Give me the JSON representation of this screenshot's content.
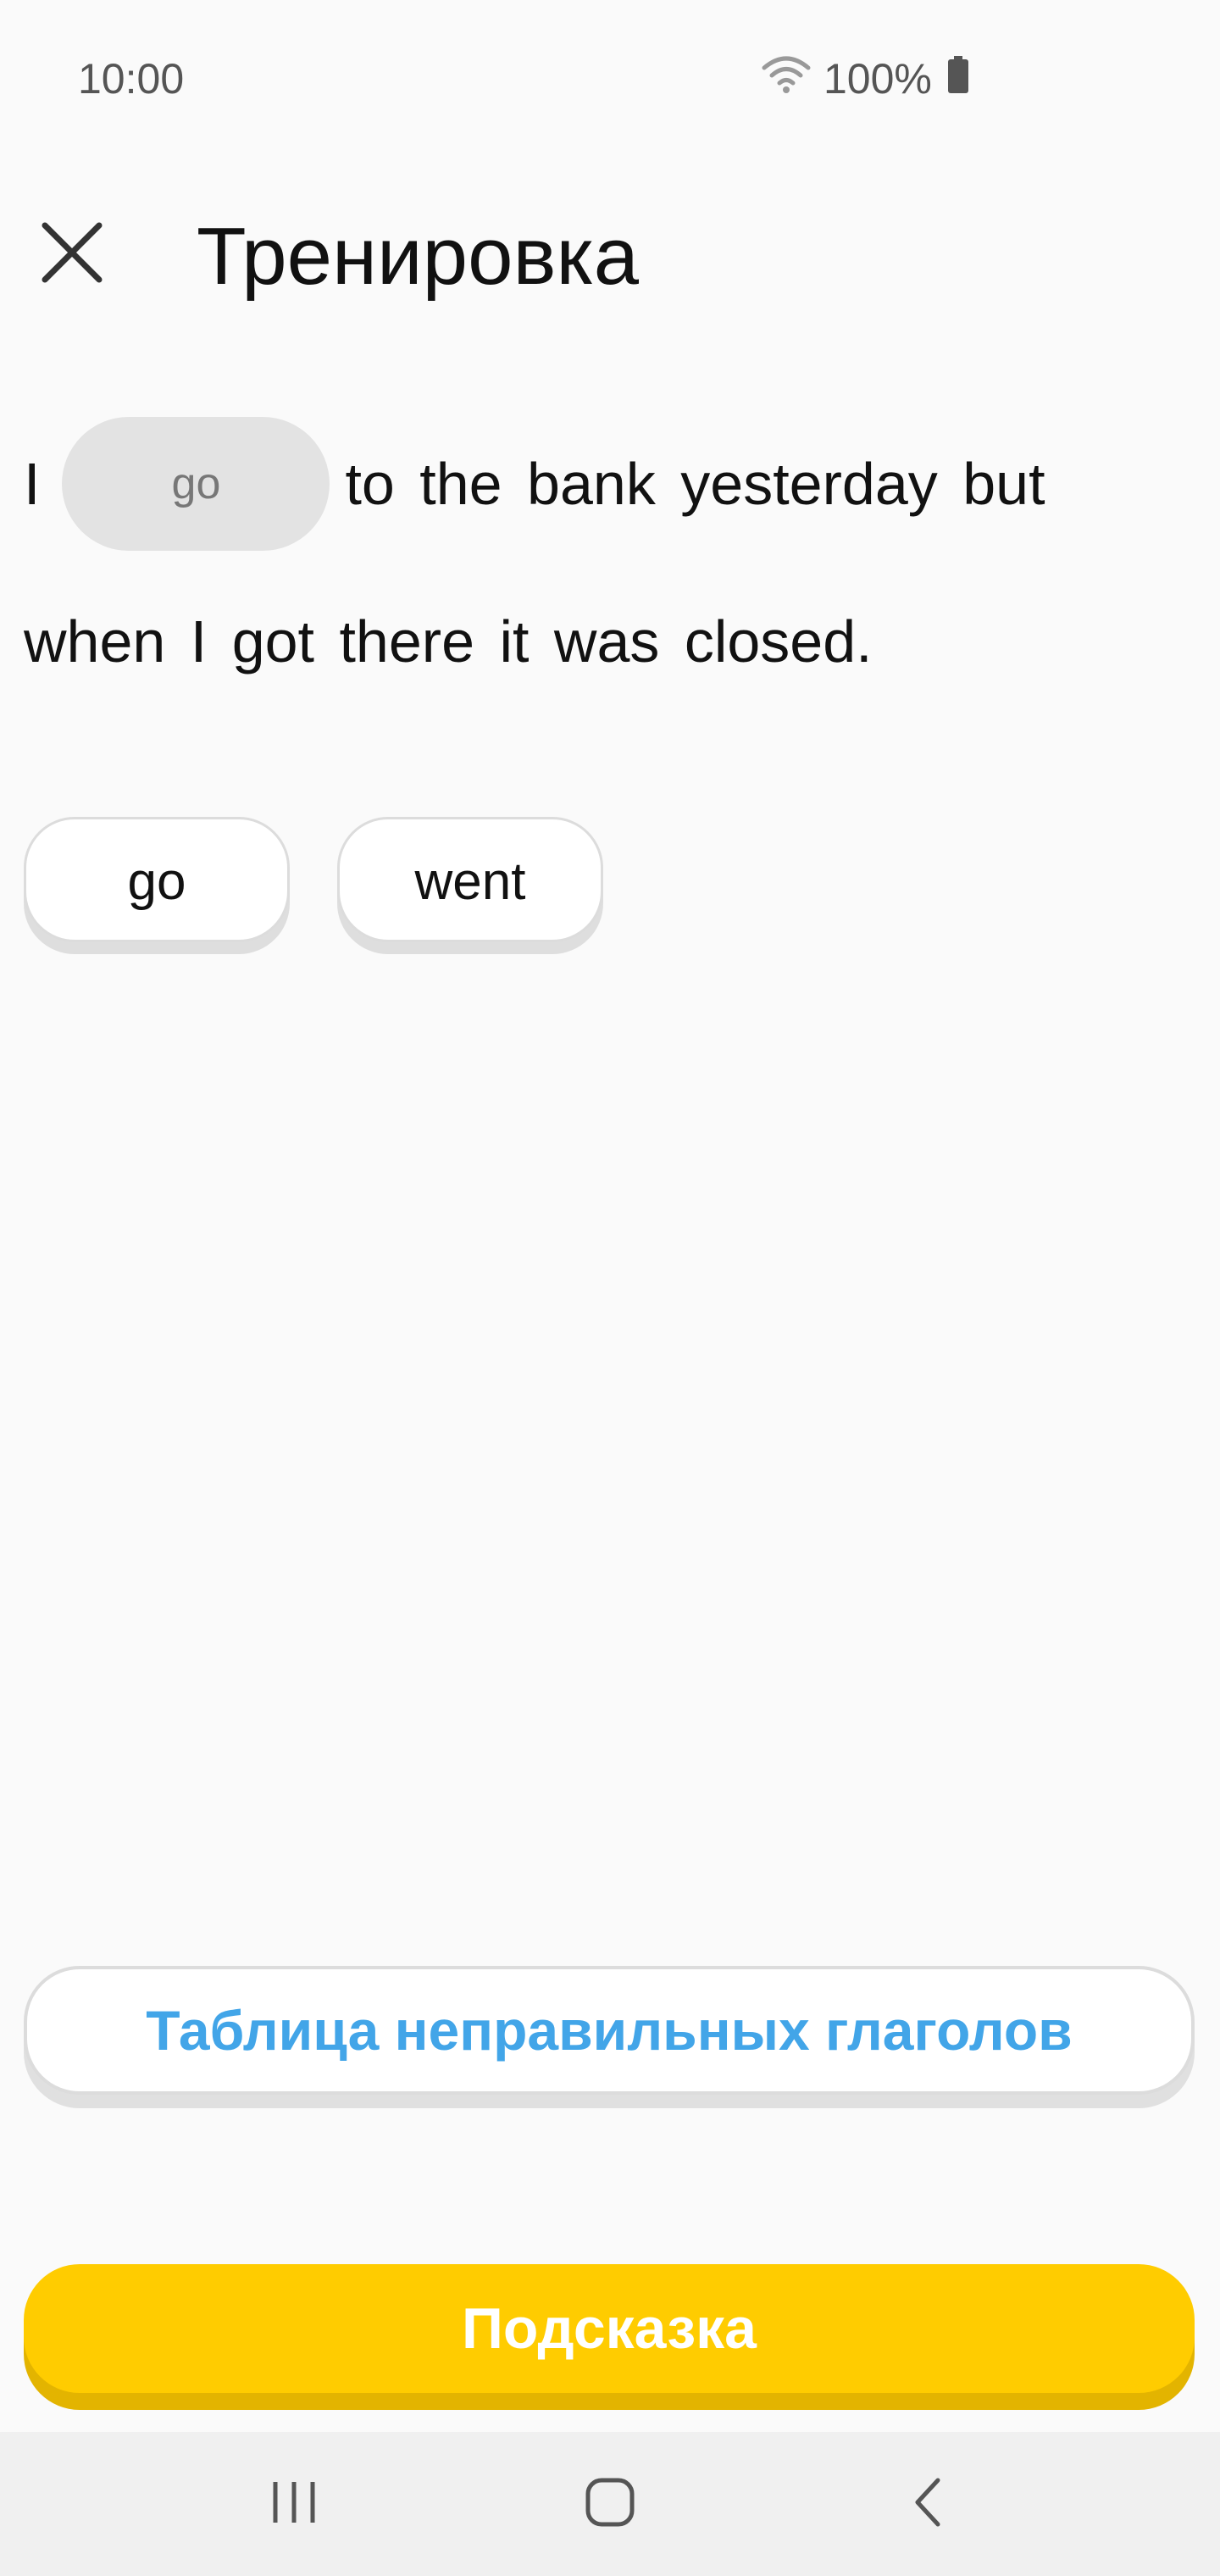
{
  "status_bar": {
    "time": "10:00",
    "battery": "100%",
    "icons": [
      "wifi-icon",
      "battery-icon"
    ]
  },
  "header": {
    "close_icon": "close-icon",
    "title": "Тренировка"
  },
  "exercise": {
    "line1_before": "I",
    "blank_value": "go",
    "line1_after": "to the bank yesterday but",
    "line2": "when I got there it was closed."
  },
  "options": [
    {
      "label": "go"
    },
    {
      "label": "went"
    }
  ],
  "buttons": {
    "irregular_verbs_table": "Таблица неправильных глаголов",
    "hint": "Подсказка"
  },
  "colors": {
    "accent_blue": "#42a5e8",
    "hint_yellow": "#ffcc00",
    "blank_gray": "#e3e3e3"
  },
  "nav_bar": {
    "icons": [
      "recents-icon",
      "home-icon",
      "back-icon"
    ]
  }
}
